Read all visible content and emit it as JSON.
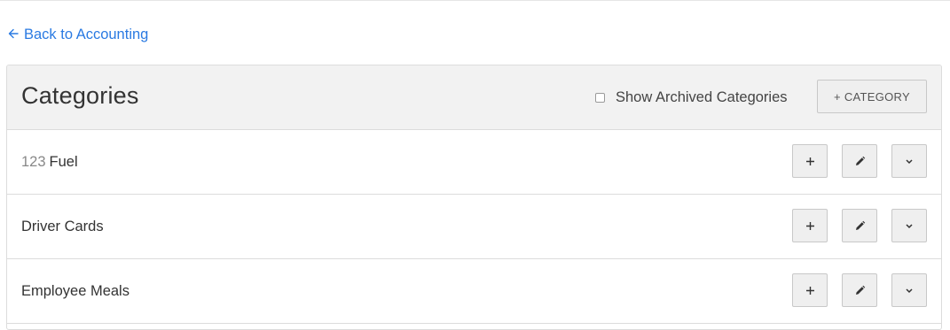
{
  "nav": {
    "back_label": "Back to Accounting"
  },
  "panel": {
    "title": "Categories",
    "show_archived_label": "Show Archived Categories",
    "show_archived_checked": false,
    "add_category_label": "+ CATEGORY"
  },
  "categories": [
    {
      "code": "123",
      "name": "Fuel"
    },
    {
      "code": "",
      "name": "Driver Cards"
    },
    {
      "code": "",
      "name": "Employee Meals"
    }
  ],
  "row_actions": {
    "add_icon": "plus-icon",
    "edit_icon": "pencil-icon",
    "menu_icon": "chevron-down-icon"
  },
  "colors": {
    "link": "#2a7ae2",
    "header_bg": "#f2f2f2",
    "border": "#dcdcdc",
    "button_bg": "#efefef"
  }
}
